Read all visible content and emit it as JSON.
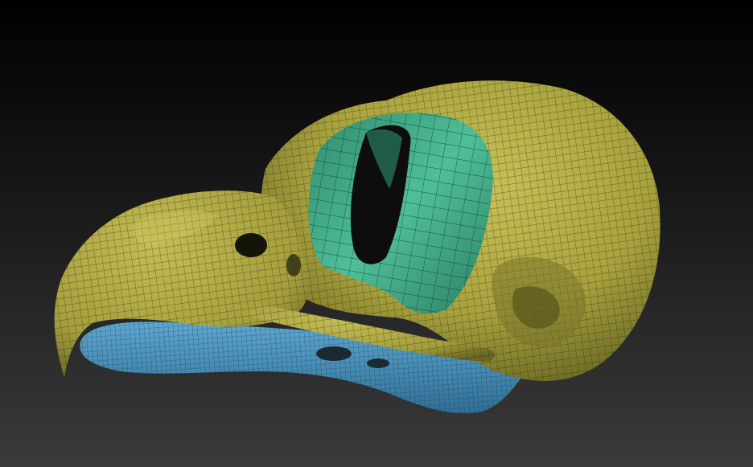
{
  "scene": {
    "subject": "bird-skull-wireframe-model",
    "parts": [
      {
        "name": "cranium-and-upper-beak",
        "color": "#b3ad45"
      },
      {
        "name": "scleral-ring",
        "color": "#3fae8c"
      },
      {
        "name": "lower-jaw",
        "color": "#4a94bf"
      }
    ],
    "background_top": "#000000",
    "background_bottom": "#3a3a3a"
  }
}
